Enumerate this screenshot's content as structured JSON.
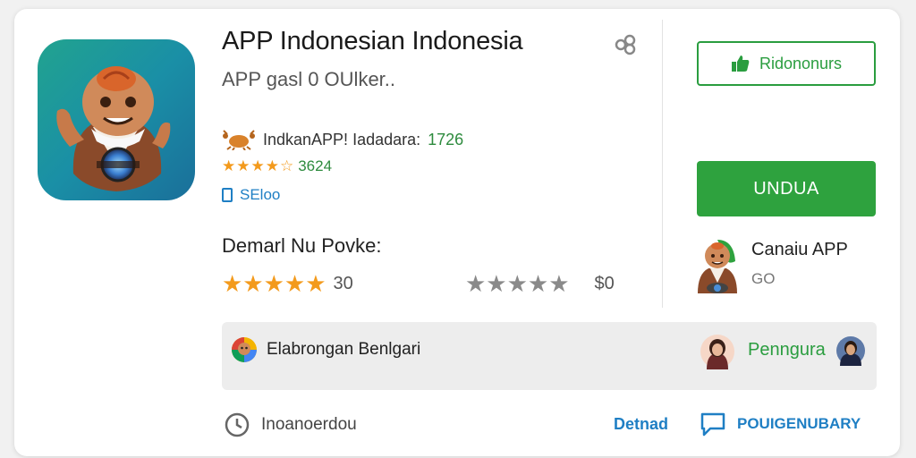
{
  "app": {
    "title": "APP Indonesian Indonesia",
    "subtitle": "APP gasl 0 OUlker..",
    "developer": "IndkanAPP! Iadadara:",
    "developer_count": "1726",
    "rating_stars": "★★★★☆",
    "rating_value": "3624",
    "save_label": "SEloo"
  },
  "reviews": {
    "section_title": "Demarl Nu Povke:",
    "row1": {
      "stars": "★★★★★",
      "count": "30"
    },
    "row2": {
      "stars": "★★★★★",
      "count": "$0"
    }
  },
  "sidebar": {
    "wishlist_label": "Ridononurs",
    "install_label": "UNDUA",
    "related_name": "Canaiu APP",
    "related_sub": "GO"
  },
  "info_bar": {
    "left_label": "Elabrongan Benlgari",
    "right_label": "Penngura"
  },
  "footer": {
    "left_label": "Inoanoerdou",
    "link1": "Detnad",
    "link2": "POUIGENUBARY"
  },
  "icons": {
    "share": "share-icon",
    "crab": "crab-icon",
    "bookmark": "bookmark-icon",
    "thumbs_up": "thumbs-up-icon",
    "clock": "clock-icon",
    "chat": "chat-icon"
  },
  "colors": {
    "green": "#2ea23e",
    "blue": "#1f7fc4",
    "star": "#f39a1c",
    "gray_star": "#8a8a8a"
  }
}
